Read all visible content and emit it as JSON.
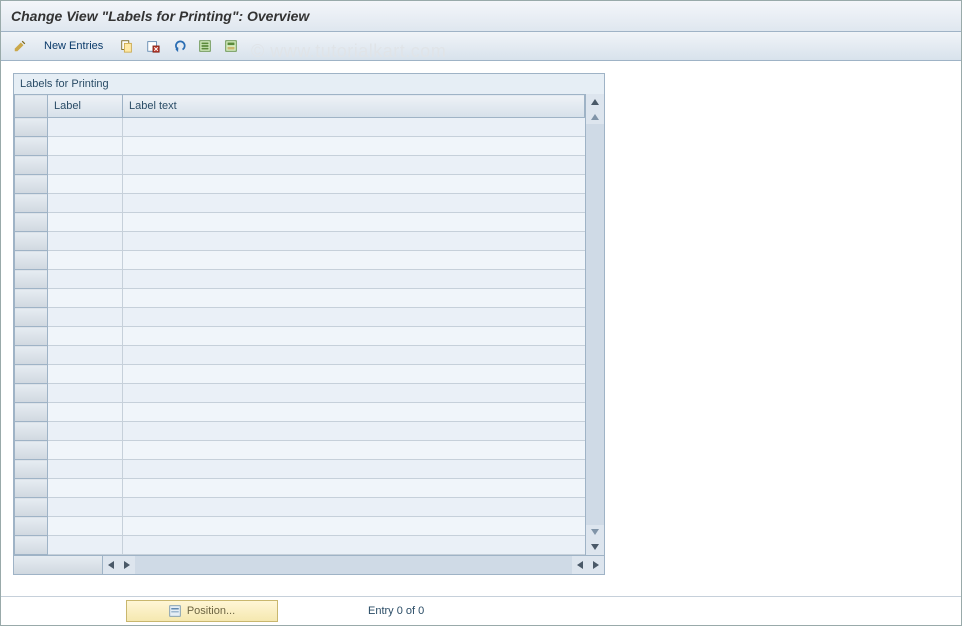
{
  "header": {
    "title": "Change View \"Labels for Printing\": Overview"
  },
  "toolbar": {
    "new_entries_label": "New Entries",
    "icons": {
      "toggle": "toggle-pencil-icon",
      "copy": "copy-icon",
      "delete": "delete-icon",
      "undo": "undo-icon",
      "select_all": "select-all-icon",
      "select_block": "select-block-icon"
    }
  },
  "watermark": "© www.tutorialkart.com",
  "panel": {
    "title": "Labels for Printing",
    "columns": {
      "col1": "Label",
      "col2": "Label text"
    },
    "rows": [
      {
        "label": "",
        "text": ""
      },
      {
        "label": "",
        "text": ""
      },
      {
        "label": "",
        "text": ""
      },
      {
        "label": "",
        "text": ""
      },
      {
        "label": "",
        "text": ""
      },
      {
        "label": "",
        "text": ""
      },
      {
        "label": "",
        "text": ""
      },
      {
        "label": "",
        "text": ""
      },
      {
        "label": "",
        "text": ""
      },
      {
        "label": "",
        "text": ""
      },
      {
        "label": "",
        "text": ""
      },
      {
        "label": "",
        "text": ""
      },
      {
        "label": "",
        "text": ""
      },
      {
        "label": "",
        "text": ""
      },
      {
        "label": "",
        "text": ""
      },
      {
        "label": "",
        "text": ""
      },
      {
        "label": "",
        "text": ""
      },
      {
        "label": "",
        "text": ""
      },
      {
        "label": "",
        "text": ""
      },
      {
        "label": "",
        "text": ""
      },
      {
        "label": "",
        "text": ""
      },
      {
        "label": "",
        "text": ""
      },
      {
        "label": "",
        "text": ""
      }
    ]
  },
  "footer": {
    "position_label": "Position...",
    "entry_text": "Entry 0 of 0"
  }
}
